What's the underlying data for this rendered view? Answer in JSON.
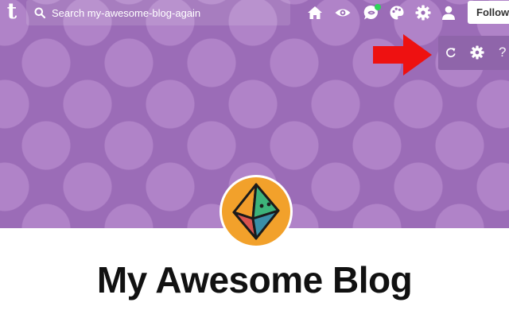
{
  "topbar": {
    "logo_text": "t",
    "search": {
      "placeholder": "Search my-awesome-blog-again",
      "value": ""
    },
    "icons": [
      "home-icon",
      "eye-icon",
      "chat-icon",
      "palette-icon",
      "gear-icon",
      "user-icon"
    ],
    "follow_label": "Follow"
  },
  "controls": {
    "icons": [
      "refresh-icon",
      "gear-icon"
    ],
    "help_label": "?"
  },
  "annotation": {
    "arrow_color": "#ee1111"
  },
  "colors": {
    "banner": "#9b6cb7",
    "banner_dots": "#b083c8",
    "avatar_bg": "#f2a12b",
    "notification": "#2fd25a"
  },
  "blog": {
    "title": "My Awesome Blog"
  }
}
